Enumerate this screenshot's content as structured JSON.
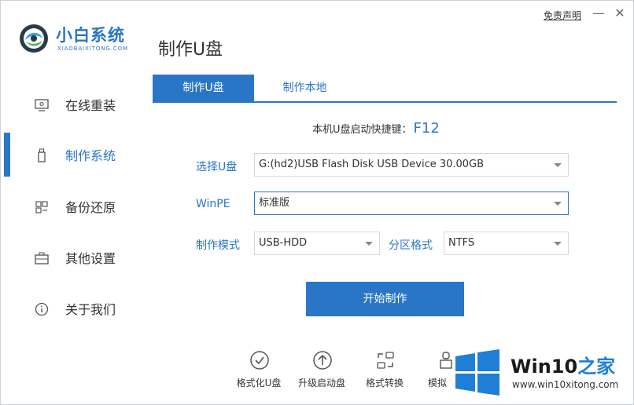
{
  "window": {
    "disclaimer": "免责声明",
    "minimize": "—",
    "close": "✕"
  },
  "logo": {
    "title": "小白系统",
    "subtitle": "XIAOBAIXITONG.COM"
  },
  "page_title": "制作U盘",
  "sidebar": {
    "items": [
      {
        "label": "在线重装",
        "icon": "monitor-icon",
        "active": false
      },
      {
        "label": "制作系统",
        "icon": "usb-drive-icon",
        "active": true
      },
      {
        "label": "备份还原",
        "icon": "grid-icon",
        "active": false
      },
      {
        "label": "其他设置",
        "icon": "briefcase-icon",
        "active": false
      },
      {
        "label": "关于我们",
        "icon": "info-icon",
        "active": false
      }
    ]
  },
  "tabs": [
    {
      "label": "制作U盘",
      "active": true
    },
    {
      "label": "制作本地",
      "active": false
    }
  ],
  "hotkey": {
    "label": "本机U盘启动快捷键：",
    "key": "F12"
  },
  "form": {
    "usb_label": "选择U盘",
    "usb_value": "G:(hd2)USB Flash Disk USB Device 30.00GB",
    "winpe_label": "WinPE",
    "winpe_value": "标准版",
    "mode_label": "制作模式",
    "mode_value": "USB-HDD",
    "partition_label": "分区格式",
    "partition_value": "NTFS"
  },
  "start_button": "开始制作",
  "tools": [
    {
      "label": "格式化U盘",
      "icon": "check-circle-icon"
    },
    {
      "label": "升级启动盘",
      "icon": "arrow-up-circle-icon"
    },
    {
      "label": "格式转换",
      "icon": "convert-icon"
    },
    {
      "label": "模拟",
      "icon": "simulate-icon"
    }
  ],
  "watermark": {
    "title_part1": "Win10",
    "title_part2": "之家",
    "url": "www.win10xitong.com"
  },
  "colors": {
    "accent": "#2a76c6",
    "windows_blue": "#1f7fd6"
  }
}
